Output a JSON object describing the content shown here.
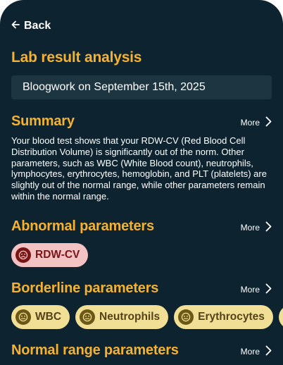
{
  "nav": {
    "back_label": "Back"
  },
  "page_title": "Lab result analysis",
  "report_select": {
    "value": "Bloogwork on September 15th, 2025"
  },
  "summary": {
    "title": "Summary",
    "more_label": "More",
    "text": "Your blood test shows that your RDW-CV (Red Blood Cell Distribution Volume) is significantly out of the norm. Other parameters, such as WBC (White Blood count), neutrophils, lymphocytes, erythrocytes, hemoglobin, and PLT (platelets) are slightly out of the normal range, while other parameters remain within the normal range."
  },
  "abnormal": {
    "title": "Abnormal parameters",
    "more_label": "More",
    "chips": [
      "RDW-CV"
    ]
  },
  "borderline": {
    "title": "Borderline parameters",
    "more_label": "More",
    "chips": [
      "WBC",
      "Neutrophils",
      "Erythrocytes",
      ""
    ]
  },
  "normal": {
    "title": "Normal range parameters",
    "more_label": "More"
  },
  "colors": {
    "background": "#0d2430",
    "accent": "#f5b12f",
    "field": "#1c3541",
    "abnormal_chip": "#f3c3c3",
    "borderline_chip": "#f1df95"
  },
  "icons": {
    "back": "arrow-left-icon",
    "more": "chevron-right-icon",
    "abnormal": "frown-face-icon",
    "borderline": "neutral-face-icon"
  }
}
